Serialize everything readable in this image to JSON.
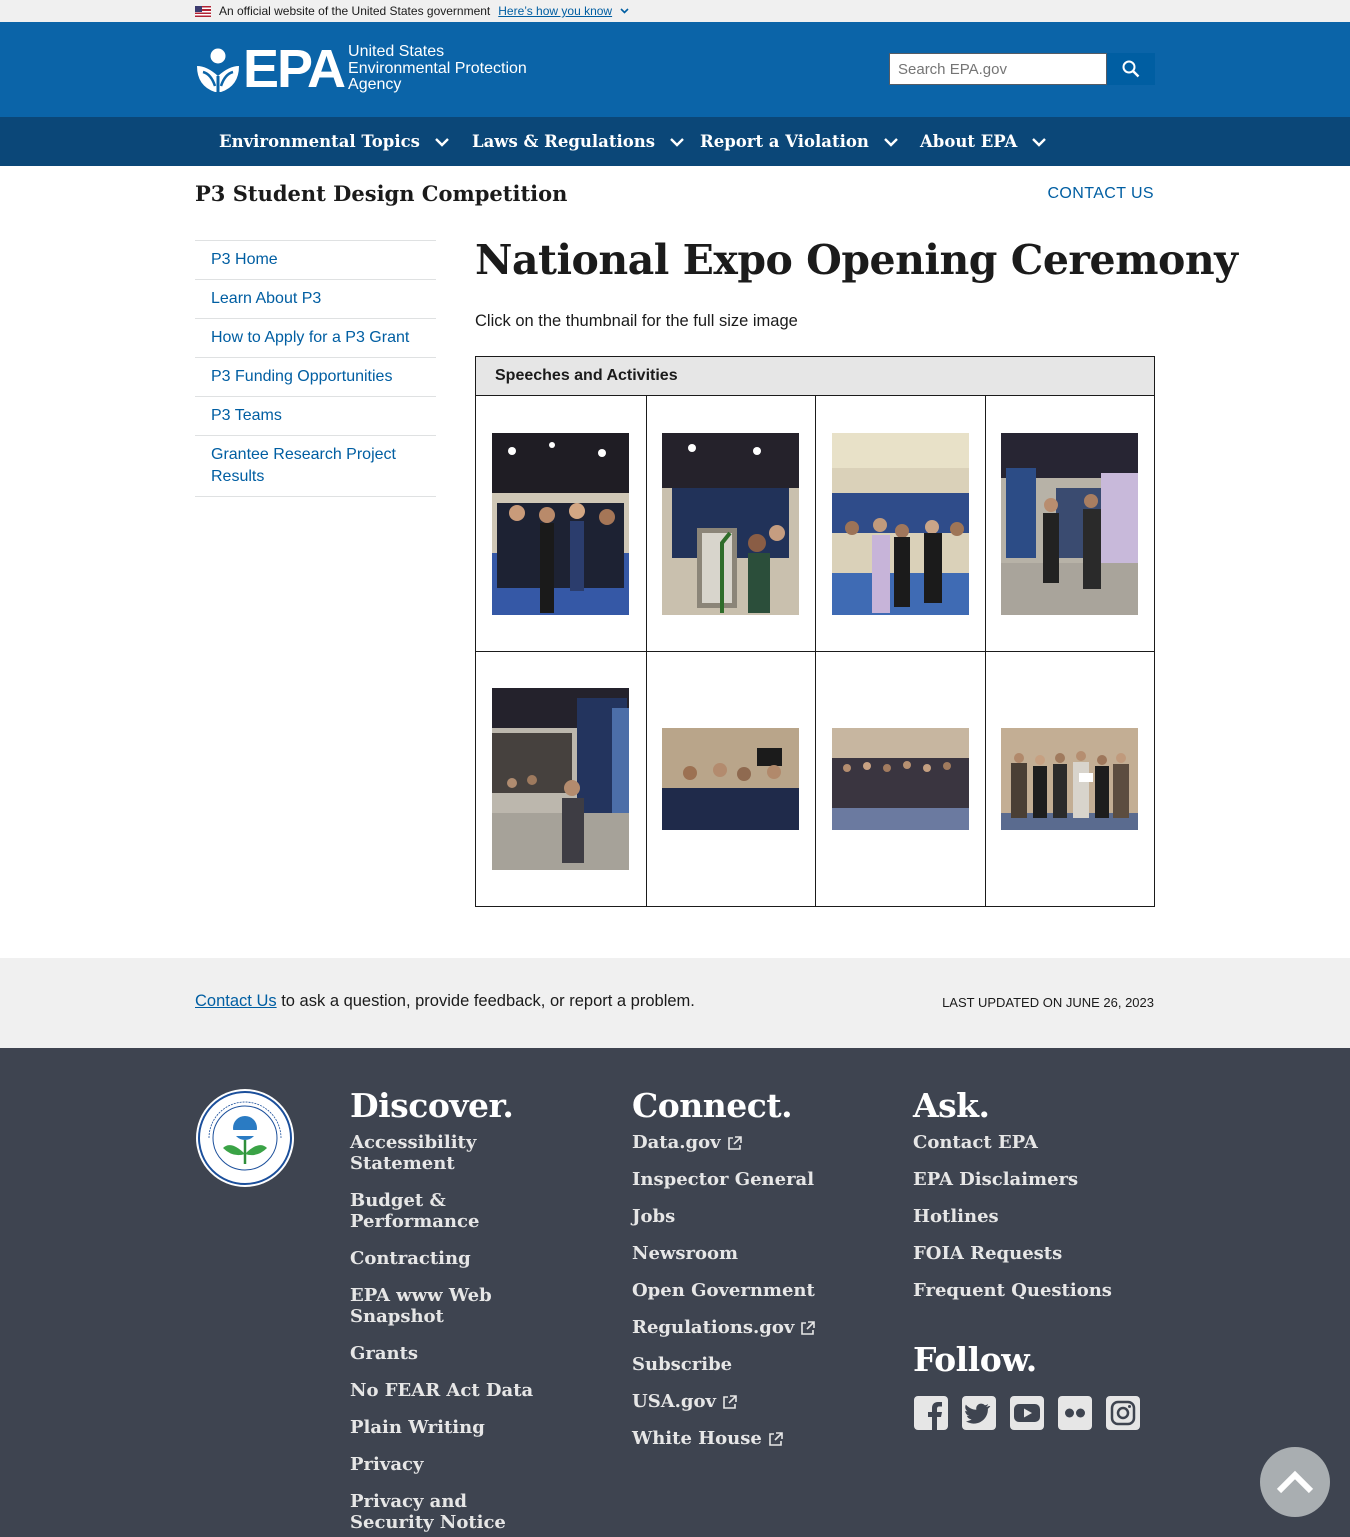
{
  "gov_banner": {
    "text": "An official website of the United States government",
    "link": "Here’s how you know"
  },
  "header": {
    "logo_letters": "EPA",
    "logo_lines": [
      "United States",
      "Environmental Protection",
      "Agency"
    ],
    "search_placeholder": "Search EPA.gov",
    "brand_color": "#0b64a8"
  },
  "nav": {
    "items": [
      {
        "label": "Environmental Topics"
      },
      {
        "label": "Laws & Regulations"
      },
      {
        "label": "Report a Violation"
      },
      {
        "label": "About EPA"
      }
    ]
  },
  "subheader": {
    "title": "P3 Student Design Competition",
    "contact": "CONTACT US"
  },
  "sidebar": {
    "items": [
      {
        "label": "P3 Home"
      },
      {
        "label": "Learn About P3"
      },
      {
        "label": "How to Apply for a P3 Grant"
      },
      {
        "label": "P3 Funding Opportunities"
      },
      {
        "label": "P3 Teams"
      },
      {
        "label": "Grantee Research Project Results"
      }
    ]
  },
  "main": {
    "title": "National Expo Opening Ceremony",
    "intro": "Click on the thumbnail for the full size image",
    "gallery_heading": "Speeches and Activities",
    "thumbnails": [
      {
        "orientation": "portrait"
      },
      {
        "orientation": "portrait"
      },
      {
        "orientation": "portrait"
      },
      {
        "orientation": "portrait"
      },
      {
        "orientation": "portrait"
      },
      {
        "orientation": "landscape"
      },
      {
        "orientation": "landscape"
      },
      {
        "orientation": "landscape"
      }
    ]
  },
  "footer_top": {
    "contact_link": "Contact Us",
    "contact_text": " to ask a question, provide feedback, or report a problem.",
    "last_updated": "LAST UPDATED ON JUNE 26, 2023"
  },
  "footer": {
    "discover": {
      "heading": "Discover.",
      "links": [
        "Accessibility Statement",
        "Budget & Performance",
        "Contracting",
        "EPA www Web Snapshot",
        "Grants",
        "No FEAR Act Data",
        "Plain Writing",
        "Privacy",
        "Privacy and Security Notice"
      ]
    },
    "connect": {
      "heading": "Connect.",
      "links": [
        "Data.gov",
        "Inspector General",
        "Jobs",
        "Newsroom",
        "Open Government",
        "Regulations.gov",
        "Subscribe",
        "USA.gov",
        "White House"
      ]
    },
    "ask": {
      "heading": "Ask.",
      "links": [
        "Contact EPA",
        "EPA Disclaimers",
        "Hotlines",
        "FOIA Requests",
        "Frequent Questions"
      ]
    },
    "follow": {
      "heading": "Follow.",
      "icons": [
        "facebook-icon",
        "twitter-icon",
        "youtube-icon",
        "flickr-icon",
        "instagram-icon"
      ]
    },
    "background": "#3e4450"
  }
}
